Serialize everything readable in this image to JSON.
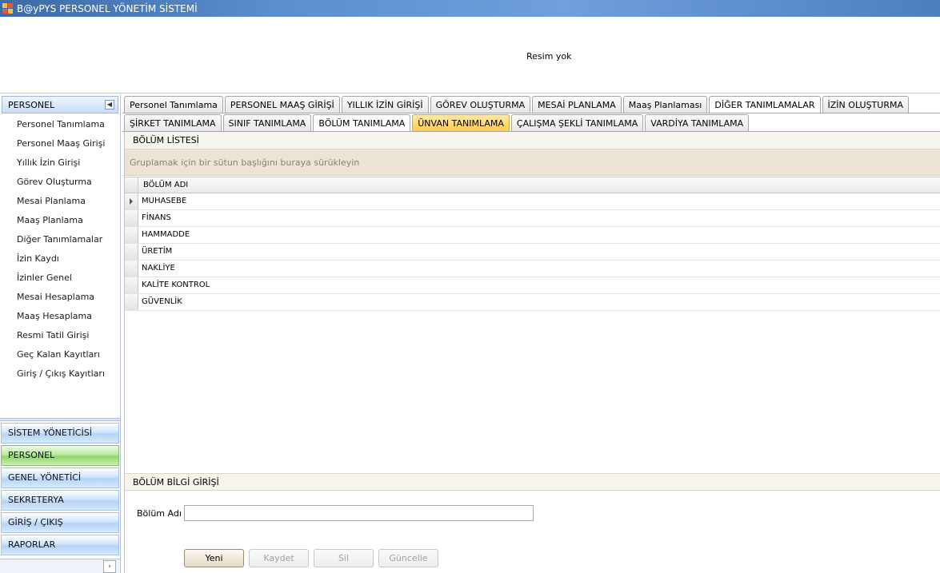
{
  "window": {
    "title": "B@yPYS PERSONEL YÖNETİM SİSTEMİ"
  },
  "header": {
    "image_placeholder": "Resim yok"
  },
  "sidebar": {
    "section_title": "PERSONEL",
    "items": [
      {
        "label": "Personel Tanımlama"
      },
      {
        "label": "Personel Maaş Girişi"
      },
      {
        "label": "Yıllık İzin Girişi"
      },
      {
        "label": "Görev Oluşturma"
      },
      {
        "label": "Mesai Planlama"
      },
      {
        "label": "Maaş Planlama"
      },
      {
        "label": "Diğer Tanımlamalar"
      },
      {
        "label": "İzin Kaydı"
      },
      {
        "label": "İzinler Genel"
      },
      {
        "label": "Mesai Hesaplama"
      },
      {
        "label": "Maaş Hesaplama"
      },
      {
        "label": "Resmi Tatil Girişi"
      },
      {
        "label": "Geç Kalan Kayıtları"
      },
      {
        "label": "Giriş / Çıkış Kayıtları"
      }
    ],
    "groups": [
      {
        "label": "SİSTEM YÖNETİCİSİ"
      },
      {
        "label": "PERSONEL"
      },
      {
        "label": "GENEL YÖNETİCİ"
      },
      {
        "label": "SEKRETERYA"
      },
      {
        "label": "GİRİŞ / ÇIKIŞ"
      },
      {
        "label": "RAPORLAR"
      }
    ]
  },
  "tabs_main": [
    {
      "label": "Personel Tanımlama"
    },
    {
      "label": "PERSONEL MAAŞ GİRİŞİ"
    },
    {
      "label": "YILLIK İZİN GİRİŞİ"
    },
    {
      "label": "GÖREV OLUŞTURMA"
    },
    {
      "label": "MESAİ PLANLAMA"
    },
    {
      "label": "Maaş Planlaması"
    },
    {
      "label": "DİĞER TANIMLAMALAR"
    },
    {
      "label": "İZİN OLUŞTURMA"
    }
  ],
  "tabs_sub": [
    {
      "label": "ŞİRKET TANIMLAMA"
    },
    {
      "label": "SINIF TANIMLAMA"
    },
    {
      "label": "BÖLÜM TANIMLAMA"
    },
    {
      "label": "ÜNVAN TANIMLAMA"
    },
    {
      "label": "ÇALIŞMA ŞEKLİ TANIMLAMA"
    },
    {
      "label": "VARDİYA TANIMLAMA"
    }
  ],
  "list_panel": {
    "title": "BÖLÜM LİSTESİ",
    "group_hint": "Gruplamak için bir sütun başlığını buraya sürükleyin",
    "column_header": "BÖLÜM ADI",
    "rows": [
      "MUHASEBE",
      "FİNANS",
      "HAMMADDE",
      "ÜRETİM",
      "NAKLİYE",
      "KALİTE KONTROL",
      "GÜVENLİK"
    ]
  },
  "info_panel": {
    "title": "BÖLÜM BİLGİ GİRİŞİ",
    "field_label": "Bölüm Adı :",
    "field_value": "",
    "buttons": {
      "new": "Yeni",
      "save": "Kaydet",
      "delete": "Sil",
      "update": "Güncelle"
    }
  }
}
